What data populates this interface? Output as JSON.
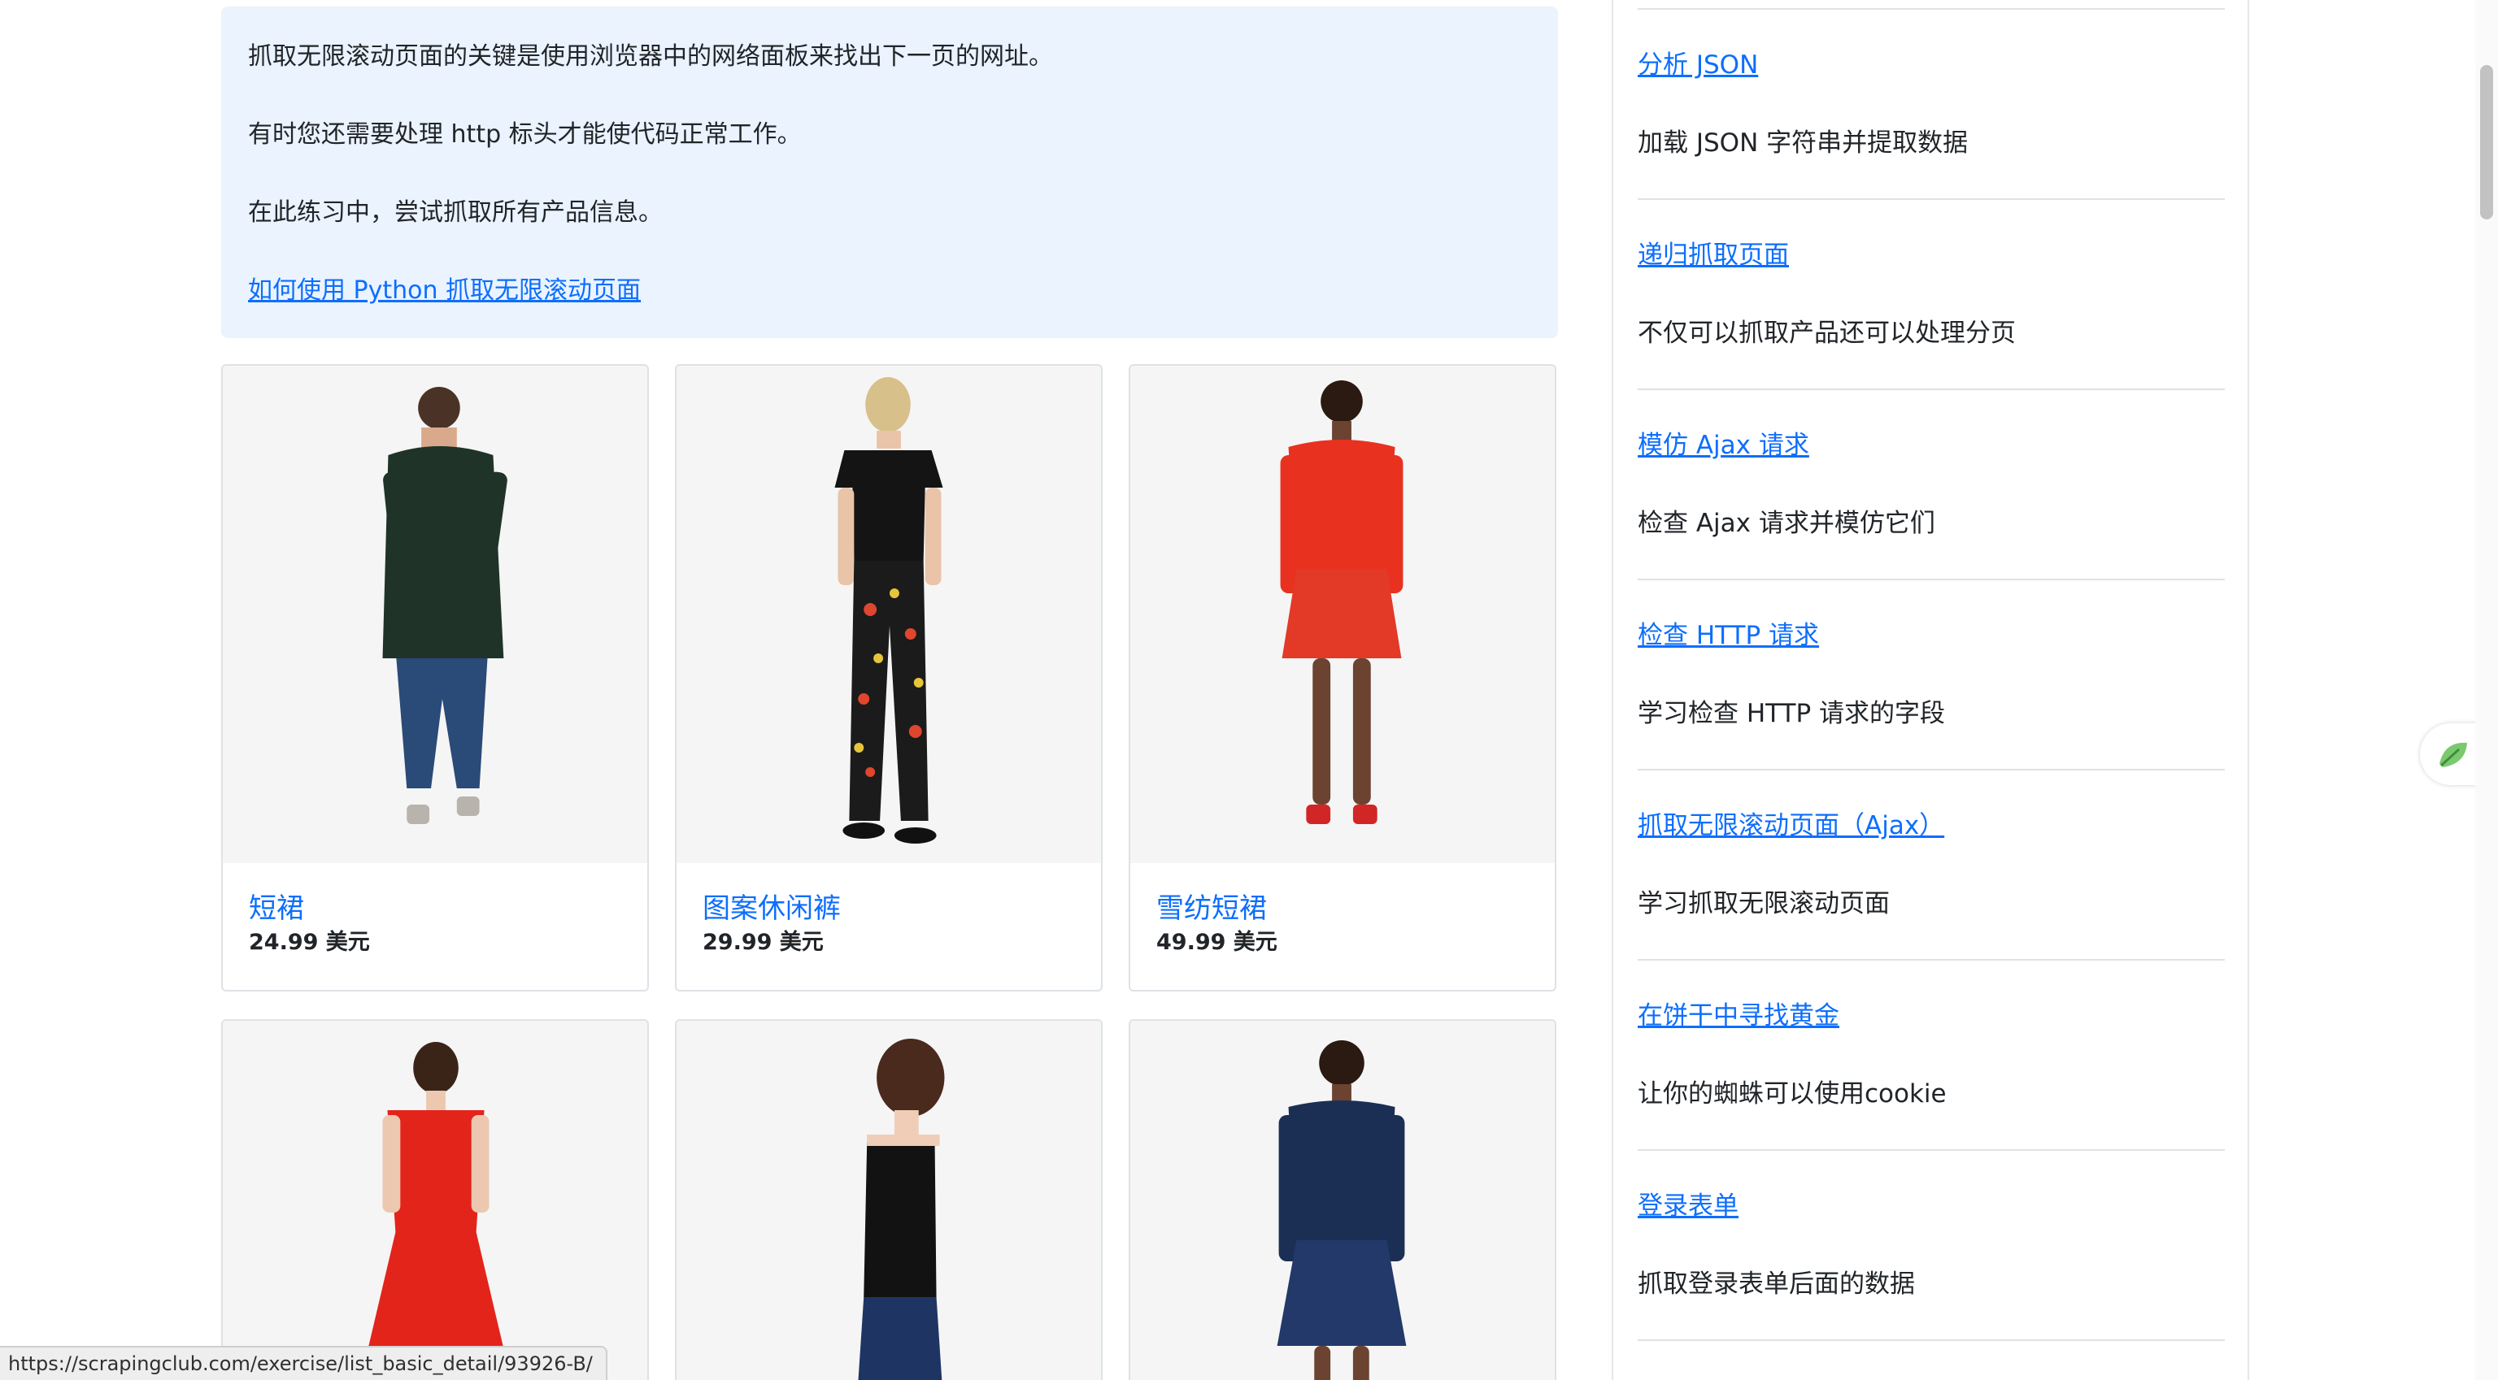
{
  "intro": {
    "lines": [
      "抓取无限滚动页面的关键是使用浏览器中的网络面板来找出下一页的网址。",
      "有时您还需要处理 http 标头才能使代码正常工作。",
      "在此练习中，尝试抓取所有产品信息。"
    ],
    "link_label": "如何使用 Python 抓取无限滚动页面"
  },
  "products": [
    {
      "name": "短裙",
      "price": "24.99 美元"
    },
    {
      "name": "图案休闲裤",
      "price": "29.99 美元"
    },
    {
      "name": "雪纺短裙",
      "price": "49.99 美元"
    },
    {
      "name": "",
      "price": ""
    },
    {
      "name": "",
      "price": ""
    },
    {
      "name": "",
      "price": ""
    }
  ],
  "sidebar": {
    "items": [
      {
        "title": "分析 JSON",
        "desc": "加载 JSON 字符串并提取数据"
      },
      {
        "title": "递归抓取页面",
        "desc": "不仅可以抓取产品还可以处理分页"
      },
      {
        "title": "模仿 Ajax 请求",
        "desc": "检查 Ajax 请求并模仿它们"
      },
      {
        "title": "检查 HTTP 请求",
        "desc": "学习检查 HTTP 请求的字段"
      },
      {
        "title": "抓取无限滚动页面（Ajax）",
        "desc": "学习抓取无限滚动页面"
      },
      {
        "title": "在饼干中寻找黄金",
        "desc": "让你的蜘蛛可以使用cookie"
      },
      {
        "title": "登录表单",
        "desc": "抓取登录表单后面的数据"
      }
    ]
  },
  "status_bar": {
    "url": "https://scrapingclub.com/exercise/list_basic_detail/93926-B/"
  },
  "colors": {
    "link": "#0d6efd",
    "info_bg": "#eaf3fe"
  }
}
